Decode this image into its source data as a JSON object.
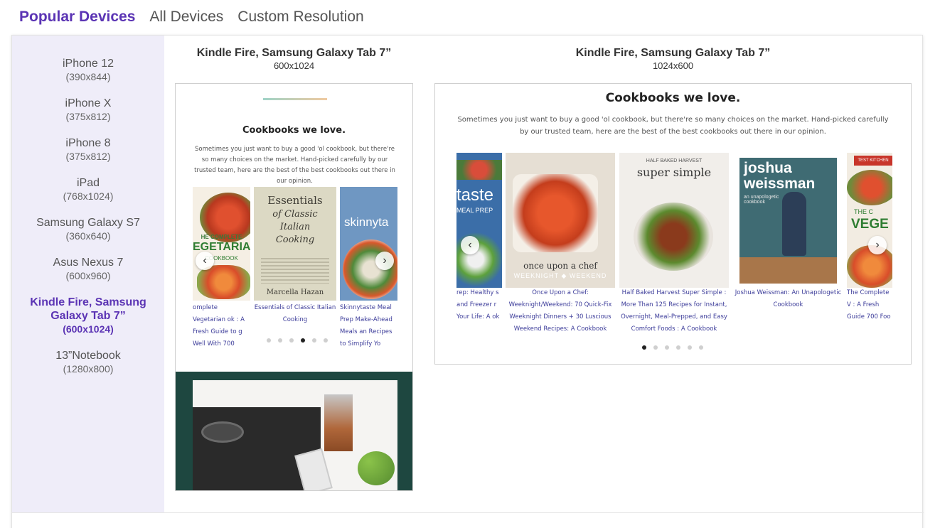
{
  "tabs": [
    {
      "label": "Popular Devices",
      "active": true
    },
    {
      "label": "All Devices",
      "active": false
    },
    {
      "label": "Custom Resolution",
      "active": false
    }
  ],
  "devices": [
    {
      "name": "iPhone 12",
      "res": "(390x844)"
    },
    {
      "name": "iPhone X",
      "res": "(375x812)"
    },
    {
      "name": "iPhone 8",
      "res": "(375x812)"
    },
    {
      "name": "iPad",
      "res": "(768x1024)"
    },
    {
      "name": "Samsung Galaxy S7",
      "res": "(360x640)"
    },
    {
      "name": "Asus Nexus 7",
      "res": "(600x960)"
    },
    {
      "name": "Kindle Fire, Samsung Galaxy Tab 7”",
      "res": "(600x1024)",
      "active": true
    },
    {
      "name": "13”Notebook",
      "res": "(1280x800)"
    }
  ],
  "frames": {
    "portrait": {
      "title": "Kindle Fire, Samsung Galaxy Tab 7”",
      "res": "600x1024"
    },
    "landscape": {
      "title": "Kindle Fire, Samsung Galaxy Tab 7”",
      "res": "1024x600"
    }
  },
  "content": {
    "heading": "Cookbooks we love.",
    "description": "Sometimes you just want to buy a good 'ol cookbook, but there're so many choices on the market. Hand-picked carefully by our trusted team, here are the best of the best cookbooks out there in our opinion."
  },
  "portrait_books": [
    {
      "cover_top": "HE COMPLETE",
      "cover_main": "EGETARIAN",
      "cover_sub": "COOKBOOK",
      "caption": "omplete Vegetarian ok : A Fresh Guide to g Well With 700"
    },
    {
      "cover_top": "Essentials",
      "cover_main": "of Classic Italian Cooking",
      "cover_sub": "Marcella Hazan",
      "caption": "Essentials of Classic Italian Cooking"
    },
    {
      "cover_top": "",
      "cover_main": "skinnyta",
      "cover_sub": "",
      "caption": "Skinnytaste Meal Prep Make-Ahead Meals an Recipes to Simplify Yo"
    }
  ],
  "landscape_books": [
    {
      "cover_main": "taste",
      "cover_sub": "MEAL PREP",
      "caption": "rep: Healthy s and Freezer r Your Life: A ok"
    },
    {
      "cover_main": "once upon a chef",
      "cover_sub": "WEEKNIGHT ◆ WEEKEND",
      "caption": "Once Upon a Chef: Weeknight/Weekend: 70 Quick-Fix Weeknight Dinners + 30 Luscious Weekend Recipes: A Cookbook"
    },
    {
      "cover_top": "HALF BAKED HARVEST",
      "cover_main": "super simple",
      "caption": "Half Baked Harvest Super Simple : More Than 125 Recipes for Instant, Overnight, Meal-Prepped, and Easy Comfort Foods : A Cookbook"
    },
    {
      "cover_main": "joshua weissman",
      "cover_sub": "an unapologetic cookbook",
      "caption": "Joshua Weissman: An Unapologetic Cookbook"
    },
    {
      "cover_top": "TEST KITCHEN",
      "cover_main": "VEGE",
      "cover_sub": "THE C",
      "caption": "The Complete V : A Fresh Guide 700 Foo"
    }
  ],
  "carousel": {
    "prev_symbol": "‹",
    "next_symbol": "›",
    "portrait_dots": 6,
    "portrait_active_dot": 4,
    "landscape_dots": 6,
    "landscape_active_dot": 1
  },
  "colors": {
    "accent": "#5b34b4",
    "sidebar_bg": "#efedf9",
    "caption_link": "#3d3d9a",
    "hero_bg": "#1e4740"
  }
}
